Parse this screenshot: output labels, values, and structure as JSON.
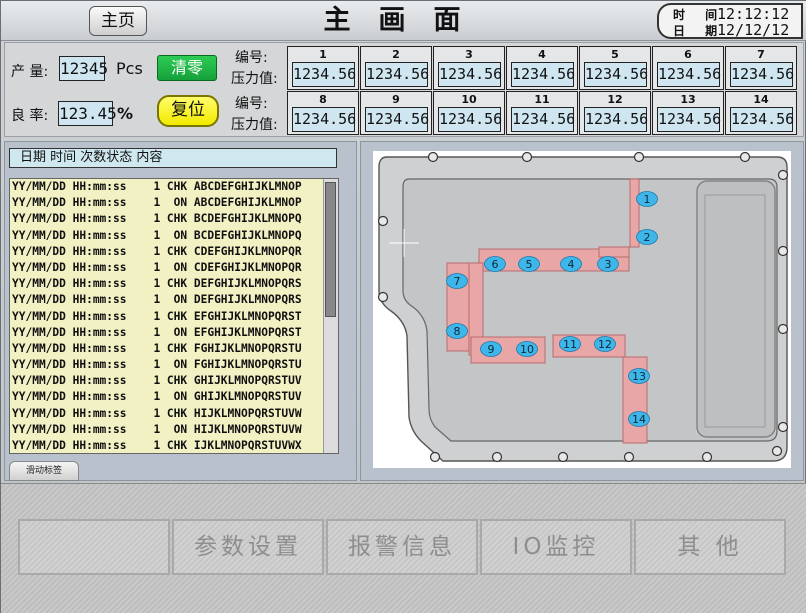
{
  "header": {
    "home_label": "主页",
    "title": "主画面",
    "time_label": "时 间",
    "time_value": "12:12:12",
    "date_label": "日 期",
    "date_value": "12/12/12"
  },
  "production": {
    "output_label": "产 量:",
    "output_value": "12345",
    "output_unit": "Pcs",
    "yield_label": "良 率:",
    "yield_value": "123.45",
    "yield_unit": "%",
    "clear_label": "清零",
    "reset_label": "复位"
  },
  "pressure": {
    "number_label": "编号:",
    "value_label": "压力值:",
    "cells": [
      {
        "num": "1",
        "value": "1234.56"
      },
      {
        "num": "2",
        "value": "1234.56"
      },
      {
        "num": "3",
        "value": "1234.56"
      },
      {
        "num": "4",
        "value": "1234.56"
      },
      {
        "num": "5",
        "value": "1234.56"
      },
      {
        "num": "6",
        "value": "1234.56"
      },
      {
        "num": "7",
        "value": "1234.56"
      },
      {
        "num": "8",
        "value": "1234.56"
      },
      {
        "num": "9",
        "value": "1234.56"
      },
      {
        "num": "10",
        "value": "1234.56"
      },
      {
        "num": "11",
        "value": "1234.56"
      },
      {
        "num": "12",
        "value": "1234.56"
      },
      {
        "num": "13",
        "value": "1234.56"
      },
      {
        "num": "14",
        "value": "1234.56"
      }
    ]
  },
  "log": {
    "header": "日期    时间    次数状态    内容",
    "rows": [
      "YY/MM/DD HH:mm:ss    1 CHK ABCDEFGHIJKLMNOP",
      "YY/MM/DD HH:mm:ss    1  ON ABCDEFGHIJKLMNOP",
      "YY/MM/DD HH:mm:ss    1 CHK BCDEFGHIJKLMNOPQ",
      "YY/MM/DD HH:mm:ss    1  ON BCDEFGHIJKLMNOPQ",
      "YY/MM/DD HH:mm:ss    1 CHK CDEFGHIJKLMNOPQR",
      "YY/MM/DD HH:mm:ss    1  ON CDEFGHIJKLMNOPQR",
      "YY/MM/DD HH:mm:ss    1 CHK DEFGHIJKLMNOPQRS",
      "YY/MM/DD HH:mm:ss    1  ON DEFGHIJKLMNOPQRS",
      "YY/MM/DD HH:mm:ss    1 CHK EFGHIJKLMNOPQRST",
      "YY/MM/DD HH:mm:ss    1  ON EFGHIJKLMNOPQRST",
      "YY/MM/DD HH:mm:ss    1 CHK FGHIJKLMNOPQRSTU",
      "YY/MM/DD HH:mm:ss    1  ON FGHIJKLMNOPQRSTU",
      "YY/MM/DD HH:mm:ss    1 CHK GHIJKLMNOPQRSTUV",
      "YY/MM/DD HH:mm:ss    1  ON GHIJKLMNOPQRSTUV",
      "YY/MM/DD HH:mm:ss    1 CHK HIJKLMNOPQRSTUVW",
      "YY/MM/DD HH:mm:ss    1  ON HIJKLMNOPQRSTUVW",
      "YY/MM/DD HH:mm:ss    1 CHK IJKLMNOPQRSTUVWX"
    ],
    "scroll_tab_label": "滑动标签"
  },
  "diagram": {
    "markers": [
      "1",
      "2",
      "3",
      "4",
      "5",
      "6",
      "7",
      "8",
      "9",
      "10",
      "11",
      "12",
      "13",
      "14"
    ],
    "colors": {
      "marker": "#3fb6ea",
      "strip": "#e9a6a6",
      "part": "#c3c5c7"
    }
  },
  "nav": {
    "items": [
      "",
      "参数设置",
      "报警信息",
      "IO监控",
      "其 他"
    ]
  }
}
